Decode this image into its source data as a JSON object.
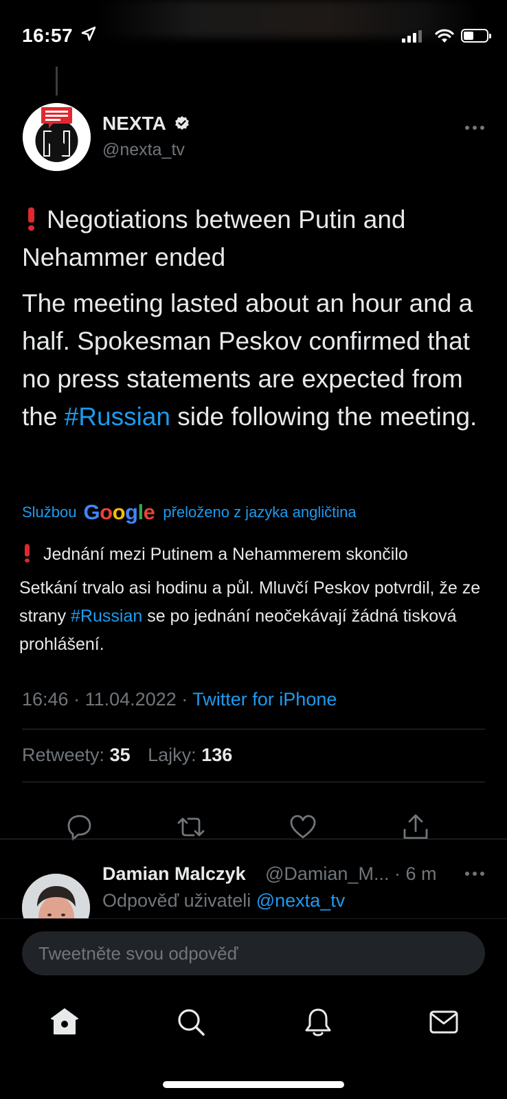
{
  "status_bar": {
    "time": "16:57"
  },
  "tweet": {
    "author_name": "NEXTA",
    "author_handle": "@nexta_tv",
    "headline": "Negotiations between Putin and Nehammer ended",
    "body_before_link": "The meeting lasted about an hour and a half. Spokesman Peskov confirmed that no press statements are expected from the ",
    "body_link": "#Russian",
    "body_after_link": " side following the meeting.",
    "translation": {
      "prefix": "Službou",
      "google_letters": [
        "G",
        "o",
        "o",
        "g",
        "l",
        "e"
      ],
      "suffix": "přeloženo z jazyka angličtina",
      "headline": "Jednání mezi Putinem a Nehammerem skončilo",
      "body_before_link": " Setkání trvalo asi hodinu a půl. Mluvčí Peskov potvrdil, že ze strany ",
      "body_link": "#Russian",
      "body_after_link": " se po jednání neočekávají žádná tisková prohlášení."
    },
    "time": "16:46",
    "date": "11.04.2022",
    "separator": "·",
    "source": "Twitter for iPhone",
    "stats": {
      "retweets_label": "Retweety:",
      "retweets_value": "35",
      "likes_label": "Lajky:",
      "likes_value": "136"
    },
    "actions": [
      "reply-icon",
      "retweet-icon",
      "like-icon",
      "share-icon"
    ]
  },
  "reply": {
    "author_name": "Damian Malczyk",
    "author_handle": "@Damian_M...",
    "time": "· 6 m",
    "replying_to_label": "Odpověď uživateli",
    "replying_to_handle": "@nexta_tv"
  },
  "compose": {
    "placeholder": "Tweetněte svou odpověď"
  },
  "tab_bar": [
    "home-icon",
    "search-icon",
    "notifications-icon",
    "messages-icon"
  ],
  "colors": {
    "background": "#000000",
    "text": "#e7e9ea",
    "secondary": "#71767b",
    "accent": "#1d9bf0",
    "divider": "#2f3336",
    "nexta_red": "#e0282e"
  }
}
